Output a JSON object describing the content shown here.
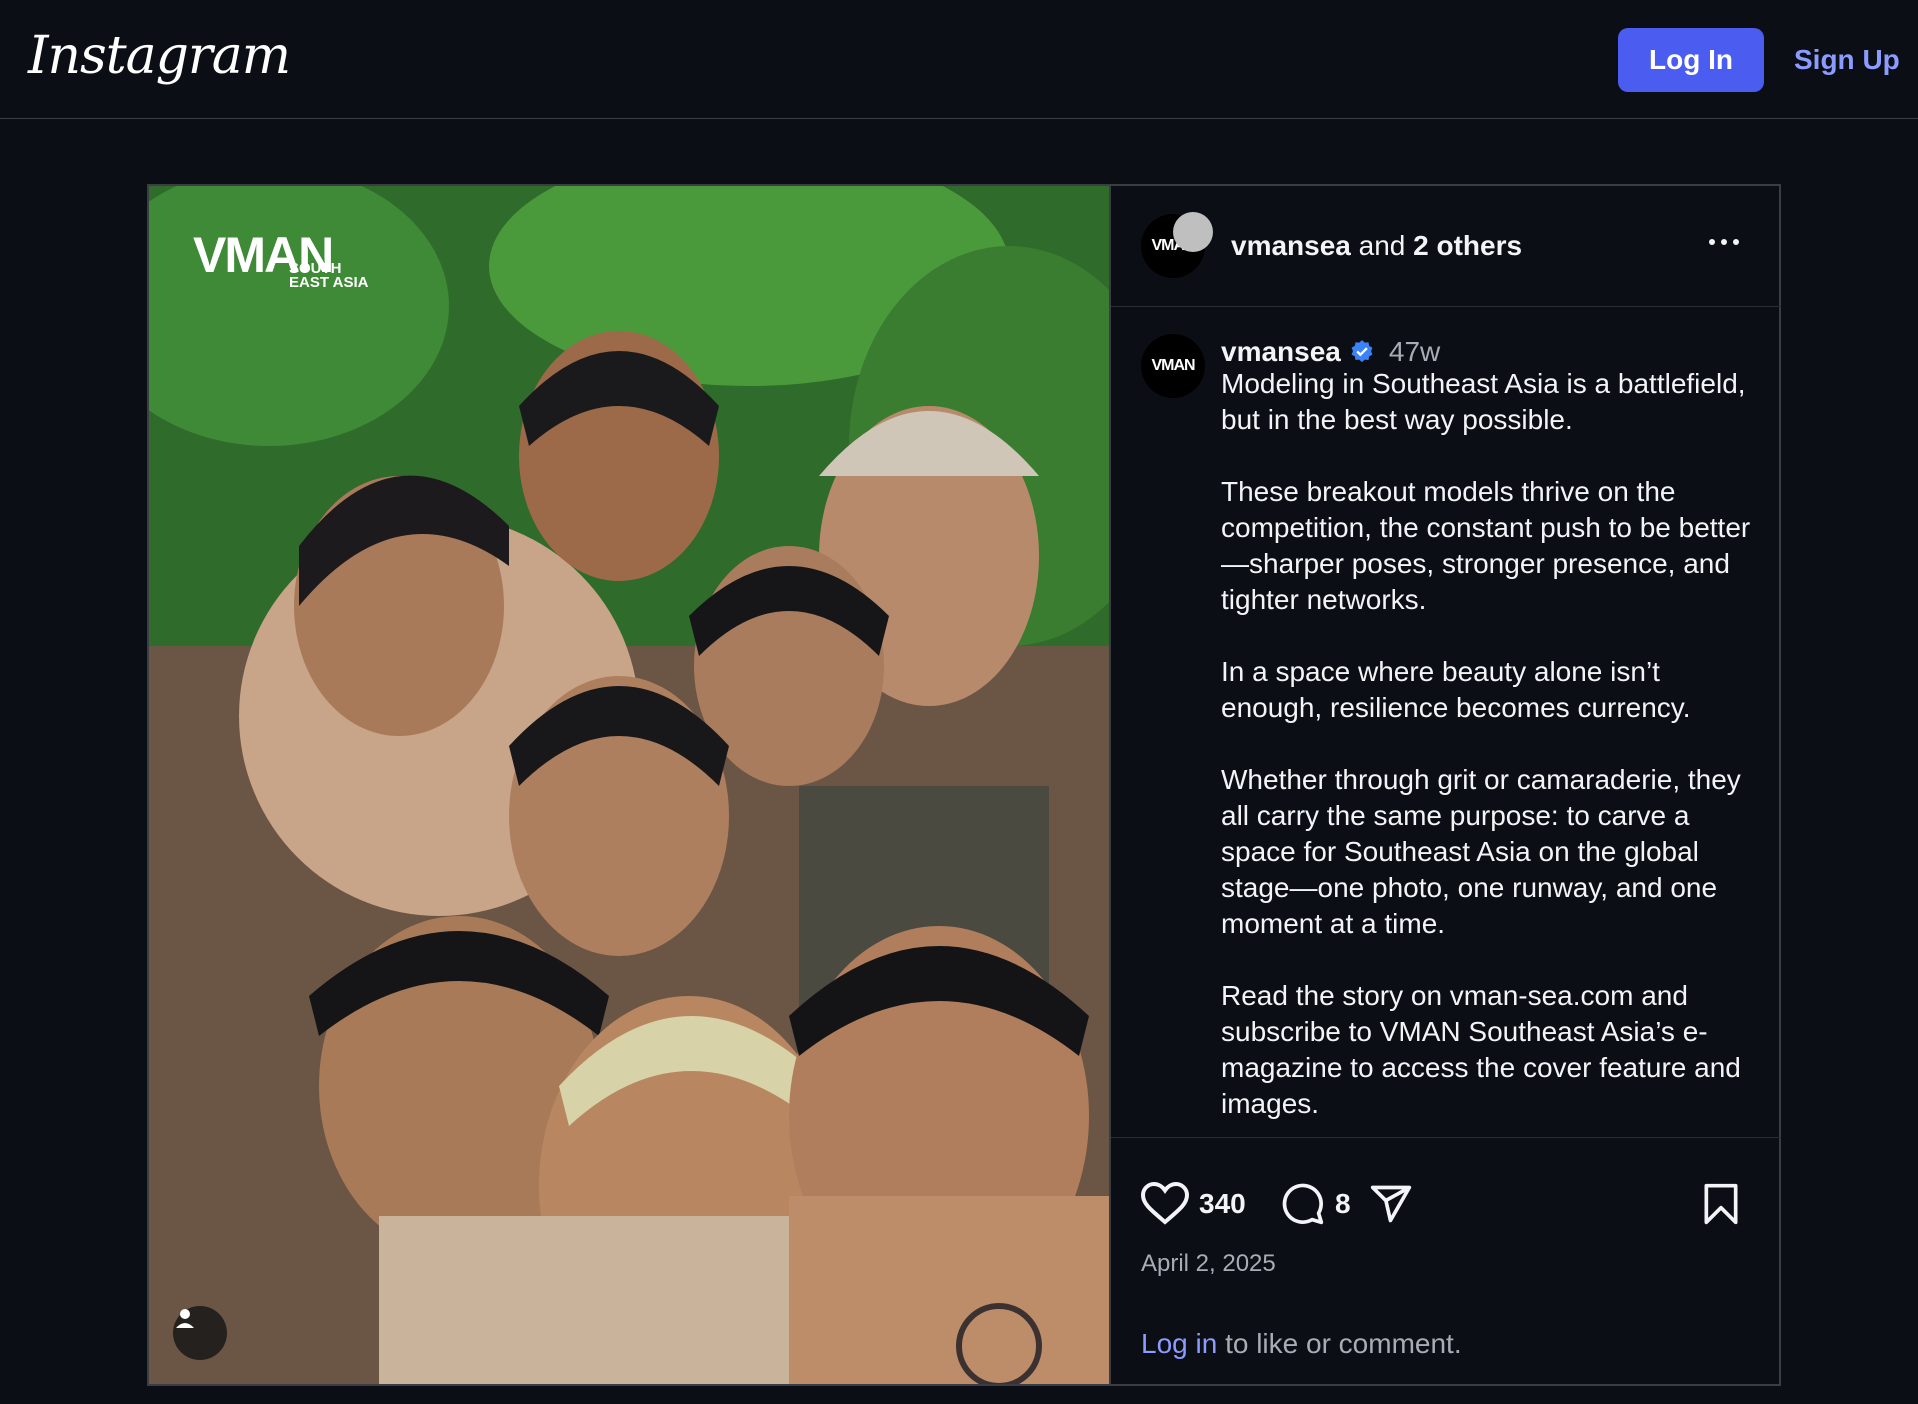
{
  "header": {
    "logo_text": "Instagram",
    "login_label": "Log In",
    "signup_label": "Sign Up"
  },
  "photo": {
    "logo_main": "VMAN",
    "logo_sub": "SOUTH EAST ASIA"
  },
  "post": {
    "author": "vmansea",
    "and_text": "and",
    "others_text": "2 others",
    "avatar_text": "VMAN",
    "time_ago": "47w",
    "caption": [
      "Modeling in Southeast Asia is a battlefield, but in the best way possible.",
      "These breakout models thrive on the competition, the constant push to be better—sharper poses, stronger presence, and tighter networks.",
      "In a space where beauty alone isn’t enough, resilience becomes currency.",
      "Whether through grit or camaraderie, they all carry the same purpose: to carve a space for Southeast Asia on the global stage—one photo, one runway, and one moment at a time.",
      "Read the story on vman-sea.com and subscribe to VMAN Southeast Asia’s e-magazine to access the cover feature and images."
    ],
    "likes": "340",
    "comments": "8",
    "date": "April 2, 2025",
    "login_link": "Log in",
    "login_suffix": " to like or comment."
  },
  "icons": [
    "heart-icon",
    "comment-icon",
    "share-icon",
    "bookmark-icon",
    "more-icon",
    "verified-icon",
    "user-tag-icon"
  ],
  "colors": {
    "background": "#0b0e14",
    "login_button": "#4a5df0",
    "link": "#8b9bff",
    "verified": "#3b82f6"
  }
}
